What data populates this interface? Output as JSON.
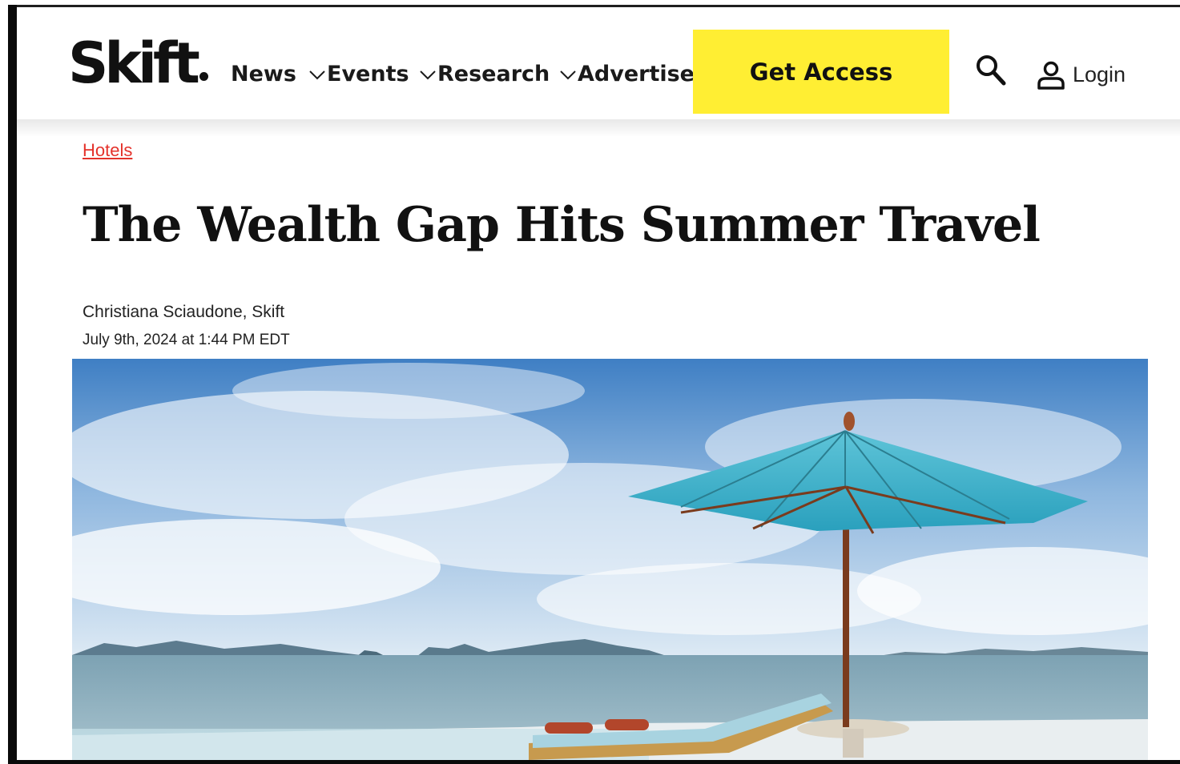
{
  "site": {
    "logo_text": "Skift",
    "colors": {
      "accent": "#ffee33",
      "category": "#e4322b",
      "text": "#111111"
    }
  },
  "nav": {
    "items": [
      {
        "label": "News",
        "has_dropdown": true
      },
      {
        "label": "Events",
        "has_dropdown": true
      },
      {
        "label": "Research",
        "has_dropdown": true
      },
      {
        "label": "Advertise",
        "has_dropdown": false
      }
    ],
    "cta_label": "Get Access",
    "search_icon": "search-icon",
    "user_icon": "user-icon",
    "login_label": "Login"
  },
  "article": {
    "category": "Hotels",
    "title": "The Wealth Gap Hits Summer Travel",
    "author": "Christiana Sciaudone, Skift",
    "date": "July 9th, 2024 at 1:44 PM EDT",
    "hero_image": "beach-umbrella-sea-photo"
  }
}
